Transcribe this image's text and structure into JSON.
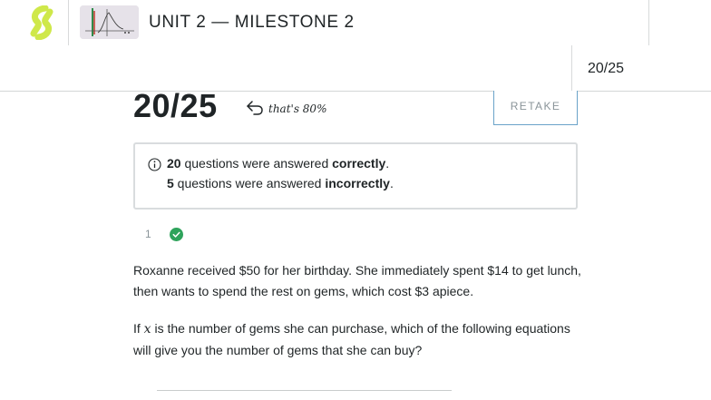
{
  "header": {
    "title": "UNIT 2 — MILESTONE 2"
  },
  "subbar": {
    "score": "20/25"
  },
  "result": {
    "score": "20/25",
    "percent_note": "that's 80%",
    "retake_label": "RETAKE"
  },
  "summary": {
    "correct_count": "20",
    "correct_pre": " questions were answered ",
    "correct_word": "correctly",
    "correct_end": ".",
    "incorrect_count": "5",
    "incorrect_pre": " questions were answered ",
    "incorrect_word": "incorrectly",
    "incorrect_end": "."
  },
  "question": {
    "number": "1",
    "status": "correct",
    "paragraph1": "Roxanne received $50 for her birthday. She immediately spent $14 to get lunch, then wants to spend the rest on gems, which cost $3 apiece.",
    "p2_before": "If ",
    "p2_var": "x",
    "p2_after": " is the number of gems she can purchase, which of the following equations will give you the number of gems that she can buy?"
  },
  "colors": {
    "logo": "#cfe84a",
    "check": "#2ea35b",
    "retake_border": "#6aa3c9",
    "divider": "#d8dadb"
  },
  "icons": [
    "logo-icon",
    "back-arrow-icon",
    "info-icon",
    "check-icon"
  ]
}
